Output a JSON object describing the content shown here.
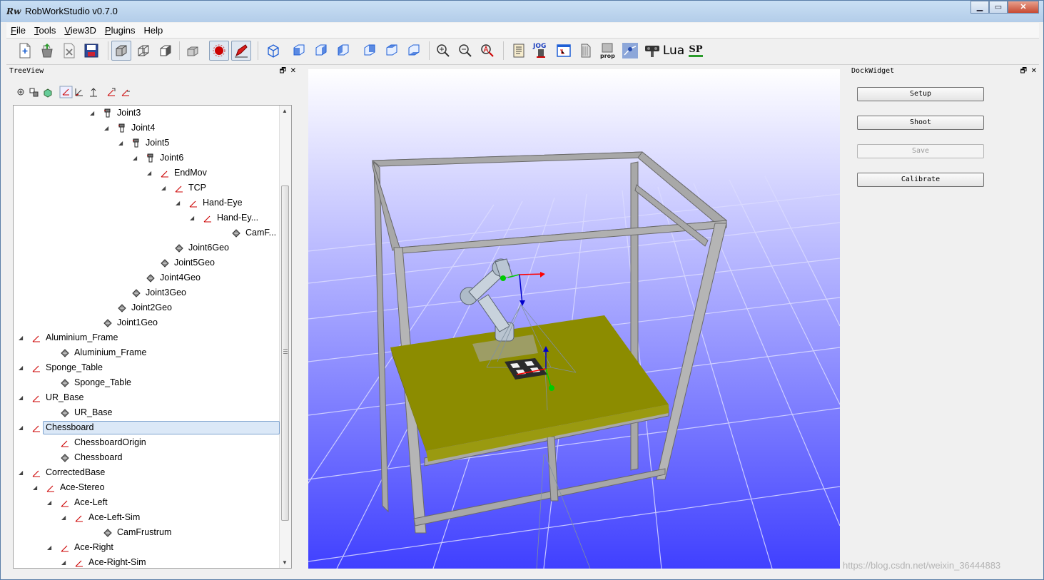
{
  "window": {
    "logo": "Rw",
    "title": "RobWorkStudio v0.7.0",
    "controls": [
      "minimize",
      "maximize",
      "close"
    ]
  },
  "menu": [
    {
      "label": "File",
      "key": "F",
      "rest": "ile"
    },
    {
      "label": "Tools",
      "key": "T",
      "rest": "ools"
    },
    {
      "label": "View3D",
      "key": "V",
      "rest": "iew3D"
    },
    {
      "label": "Plugins",
      "key": "P",
      "rest": "lugins"
    },
    {
      "label": "Help",
      "key": "",
      "rest": "Help"
    }
  ],
  "toolbar": {
    "jog_label": "JOG",
    "prop_label": "prop",
    "lua_label": "Lua",
    "sp_label": "SP",
    "icons": [
      "new-icon",
      "open-icon",
      "close-icon",
      "save-icon",
      "solid-view-icon",
      "wireframe-view-icon",
      "outline-view-icon",
      "box-icon",
      "record-icon",
      "pen-icon",
      "view-iso-icon",
      "view-front-icon",
      "view-right-icon",
      "view-left-icon",
      "view-back-icon",
      "view-top-icon",
      "view-bottom-icon",
      "zoom-in-icon",
      "zoom-out-icon",
      "zoom-fit-icon",
      "log-icon",
      "jog-icon",
      "treeview-icon",
      "playback-icon",
      "prop-icon",
      "planning-icon",
      "sensor-icon",
      "lua-icon",
      "sp-icon"
    ]
  },
  "treeview": {
    "title": "TreeView",
    "float_glyph": "🗗",
    "close_glyph": "✕",
    "tool_icons": [
      "expand-all-icon",
      "collapse-all-icon",
      "geometry-icon",
      "frame-icon",
      "frame-axes-icon",
      "frame-up-icon",
      "add-frame-icon",
      "remove-frame-icon"
    ],
    "rows": [
      {
        "label": "Joint3",
        "depth": 6,
        "icon": "joint",
        "arrow": true
      },
      {
        "label": "Joint4",
        "depth": 7,
        "icon": "joint",
        "arrow": true
      },
      {
        "label": "Joint5",
        "depth": 8,
        "icon": "joint",
        "arrow": true
      },
      {
        "label": "Joint6",
        "depth": 9,
        "icon": "joint",
        "arrow": true
      },
      {
        "label": "EndMov",
        "depth": 10,
        "icon": "frame",
        "arrow": true
      },
      {
        "label": "TCP",
        "depth": 11,
        "icon": "frame",
        "arrow": true
      },
      {
        "label": "Hand-Eye",
        "depth": 12,
        "icon": "frame",
        "arrow": true
      },
      {
        "label": "Hand-Ey...",
        "depth": 13,
        "icon": "frame",
        "arrow": true
      },
      {
        "label": "CamF...",
        "depth": 15,
        "icon": "geo",
        "arrow": false
      },
      {
        "label": "Joint6Geo",
        "depth": 11,
        "icon": "geo",
        "arrow": false
      },
      {
        "label": "Joint5Geo",
        "depth": 10,
        "icon": "geo",
        "arrow": false
      },
      {
        "label": "Joint4Geo",
        "depth": 9,
        "icon": "geo",
        "arrow": false
      },
      {
        "label": "Joint3Geo",
        "depth": 8,
        "icon": "geo",
        "arrow": false
      },
      {
        "label": "Joint2Geo",
        "depth": 7,
        "icon": "geo",
        "arrow": false
      },
      {
        "label": "Joint1Geo",
        "depth": 6,
        "icon": "geo",
        "arrow": false
      },
      {
        "label": "Aluminium_Frame",
        "depth": 1,
        "icon": "frame",
        "arrow": true
      },
      {
        "label": "Aluminium_Frame",
        "depth": 3,
        "icon": "geo",
        "arrow": false
      },
      {
        "label": "Sponge_Table",
        "depth": 1,
        "icon": "frame",
        "arrow": true
      },
      {
        "label": "Sponge_Table",
        "depth": 3,
        "icon": "geo",
        "arrow": false
      },
      {
        "label": "UR_Base",
        "depth": 1,
        "icon": "frame",
        "arrow": true
      },
      {
        "label": "UR_Base",
        "depth": 3,
        "icon": "geo",
        "arrow": false
      },
      {
        "label": "Chessboard",
        "depth": 1,
        "icon": "frame",
        "arrow": true,
        "selected": true
      },
      {
        "label": "ChessboardOrigin",
        "depth": 3,
        "icon": "frame",
        "arrow": false
      },
      {
        "label": "Chessboard",
        "depth": 3,
        "icon": "geo",
        "arrow": false
      },
      {
        "label": "CorrectedBase",
        "depth": 1,
        "icon": "frame",
        "arrow": true
      },
      {
        "label": "Ace-Stereo",
        "depth": 2,
        "icon": "frame",
        "arrow": true
      },
      {
        "label": "Ace-Left",
        "depth": 3,
        "icon": "frame",
        "arrow": true
      },
      {
        "label": "Ace-Left-Sim",
        "depth": 4,
        "icon": "frame",
        "arrow": true
      },
      {
        "label": "CamFrustrum",
        "depth": 6,
        "icon": "geo",
        "arrow": false
      },
      {
        "label": "Ace-Right",
        "depth": 3,
        "icon": "frame",
        "arrow": true
      },
      {
        "label": "Ace-Right-Sim",
        "depth": 4,
        "icon": "frame",
        "arrow": true
      }
    ]
  },
  "dock": {
    "title": "DockWidget",
    "float_glyph": "🗗",
    "close_glyph": "✕",
    "buttons": [
      {
        "label": "Setup",
        "enabled": true
      },
      {
        "label": "Shoot",
        "enabled": true
      },
      {
        "label": "Save",
        "enabled": false
      },
      {
        "label": "Calibrate",
        "enabled": true
      }
    ]
  },
  "watermark": "https://blog.csdn.net/weixin_36444883",
  "colors": {
    "frame_gray": "#a3a3a3",
    "table_olive": "#8c8c00",
    "viewport_top": "#ffffff",
    "viewport_bottom": "#4040ff",
    "axis_x": "#ff0000",
    "axis_y": "#00cc00",
    "axis_z": "#0000cc"
  }
}
